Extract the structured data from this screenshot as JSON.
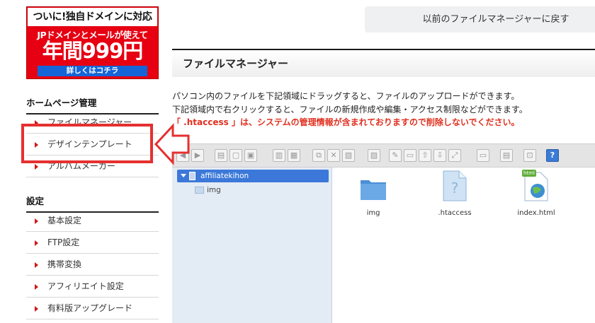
{
  "banner": {
    "line1": "ついに!独自ドメインに対応",
    "line2": "JPドメインとメールが使えて",
    "price": "年間999円",
    "button": "詳しくはコチラ"
  },
  "header": {
    "return_button": "以前のファイルマネージャーに戻す",
    "title": "ファイルマネージャー"
  },
  "sidebar": {
    "homepage_heading": "ホームページ管理",
    "homepage_items": [
      {
        "label": "ファイルマネージャー"
      },
      {
        "label": "デザインテンプレート"
      },
      {
        "label": "アルバムメーカー"
      }
    ],
    "settings_heading": "設定",
    "settings_items": [
      {
        "label": "基本設定"
      },
      {
        "label": "FTP設定"
      },
      {
        "label": "携帯変換"
      },
      {
        "label": "アフィリエイト設定"
      },
      {
        "label": "有料版アップグレード"
      }
    ]
  },
  "description": {
    "line1": "パソコン内のファイルを下記領域にドラッグすると、ファイルのアップロードができます。",
    "line2": "下記領域内で右クリックすると、ファイルの新規作成や編集・アクセス制限などができます。",
    "warning": "「 .htaccess 」は、システムの管理情報が含まれておりますので削除しないでください。"
  },
  "tree": {
    "root": "affiliatekihon",
    "children": [
      "img"
    ]
  },
  "files": [
    {
      "name": "img",
      "icon": "folder-icon"
    },
    {
      "name": ".htaccess",
      "icon": "unknown-file-icon"
    },
    {
      "name": "index.html",
      "icon": "html-file-icon",
      "badge": "html"
    }
  ],
  "colors": {
    "accent_red": "#e53030",
    "banner_red": "#e60012",
    "selection_blue": "#3b78d9",
    "warning_text": "#e03020"
  }
}
